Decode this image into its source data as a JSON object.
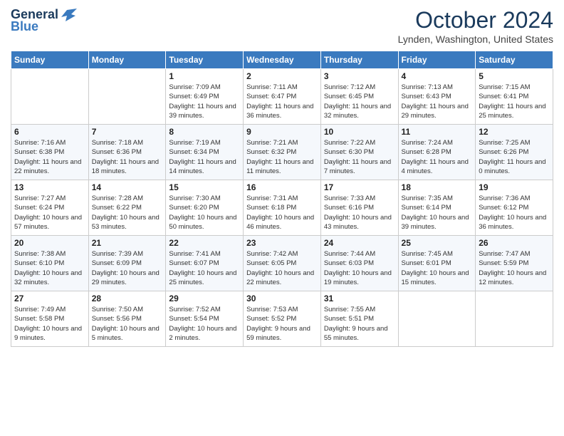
{
  "header": {
    "logo_general": "General",
    "logo_blue": "Blue",
    "month_title": "October 2024",
    "location": "Lynden, Washington, United States"
  },
  "weekdays": [
    "Sunday",
    "Monday",
    "Tuesday",
    "Wednesday",
    "Thursday",
    "Friday",
    "Saturday"
  ],
  "weeks": [
    [
      null,
      null,
      {
        "day": "1",
        "sunrise": "Sunrise: 7:09 AM",
        "sunset": "Sunset: 6:49 PM",
        "daylight": "Daylight: 11 hours and 39 minutes."
      },
      {
        "day": "2",
        "sunrise": "Sunrise: 7:11 AM",
        "sunset": "Sunset: 6:47 PM",
        "daylight": "Daylight: 11 hours and 36 minutes."
      },
      {
        "day": "3",
        "sunrise": "Sunrise: 7:12 AM",
        "sunset": "Sunset: 6:45 PM",
        "daylight": "Daylight: 11 hours and 32 minutes."
      },
      {
        "day": "4",
        "sunrise": "Sunrise: 7:13 AM",
        "sunset": "Sunset: 6:43 PM",
        "daylight": "Daylight: 11 hours and 29 minutes."
      },
      {
        "day": "5",
        "sunrise": "Sunrise: 7:15 AM",
        "sunset": "Sunset: 6:41 PM",
        "daylight": "Daylight: 11 hours and 25 minutes."
      }
    ],
    [
      {
        "day": "6",
        "sunrise": "Sunrise: 7:16 AM",
        "sunset": "Sunset: 6:38 PM",
        "daylight": "Daylight: 11 hours and 22 minutes."
      },
      {
        "day": "7",
        "sunrise": "Sunrise: 7:18 AM",
        "sunset": "Sunset: 6:36 PM",
        "daylight": "Daylight: 11 hours and 18 minutes."
      },
      {
        "day": "8",
        "sunrise": "Sunrise: 7:19 AM",
        "sunset": "Sunset: 6:34 PM",
        "daylight": "Daylight: 11 hours and 14 minutes."
      },
      {
        "day": "9",
        "sunrise": "Sunrise: 7:21 AM",
        "sunset": "Sunset: 6:32 PM",
        "daylight": "Daylight: 11 hours and 11 minutes."
      },
      {
        "day": "10",
        "sunrise": "Sunrise: 7:22 AM",
        "sunset": "Sunset: 6:30 PM",
        "daylight": "Daylight: 11 hours and 7 minutes."
      },
      {
        "day": "11",
        "sunrise": "Sunrise: 7:24 AM",
        "sunset": "Sunset: 6:28 PM",
        "daylight": "Daylight: 11 hours and 4 minutes."
      },
      {
        "day": "12",
        "sunrise": "Sunrise: 7:25 AM",
        "sunset": "Sunset: 6:26 PM",
        "daylight": "Daylight: 11 hours and 0 minutes."
      }
    ],
    [
      {
        "day": "13",
        "sunrise": "Sunrise: 7:27 AM",
        "sunset": "Sunset: 6:24 PM",
        "daylight": "Daylight: 10 hours and 57 minutes."
      },
      {
        "day": "14",
        "sunrise": "Sunrise: 7:28 AM",
        "sunset": "Sunset: 6:22 PM",
        "daylight": "Daylight: 10 hours and 53 minutes."
      },
      {
        "day": "15",
        "sunrise": "Sunrise: 7:30 AM",
        "sunset": "Sunset: 6:20 PM",
        "daylight": "Daylight: 10 hours and 50 minutes."
      },
      {
        "day": "16",
        "sunrise": "Sunrise: 7:31 AM",
        "sunset": "Sunset: 6:18 PM",
        "daylight": "Daylight: 10 hours and 46 minutes."
      },
      {
        "day": "17",
        "sunrise": "Sunrise: 7:33 AM",
        "sunset": "Sunset: 6:16 PM",
        "daylight": "Daylight: 10 hours and 43 minutes."
      },
      {
        "day": "18",
        "sunrise": "Sunrise: 7:35 AM",
        "sunset": "Sunset: 6:14 PM",
        "daylight": "Daylight: 10 hours and 39 minutes."
      },
      {
        "day": "19",
        "sunrise": "Sunrise: 7:36 AM",
        "sunset": "Sunset: 6:12 PM",
        "daylight": "Daylight: 10 hours and 36 minutes."
      }
    ],
    [
      {
        "day": "20",
        "sunrise": "Sunrise: 7:38 AM",
        "sunset": "Sunset: 6:10 PM",
        "daylight": "Daylight: 10 hours and 32 minutes."
      },
      {
        "day": "21",
        "sunrise": "Sunrise: 7:39 AM",
        "sunset": "Sunset: 6:09 PM",
        "daylight": "Daylight: 10 hours and 29 minutes."
      },
      {
        "day": "22",
        "sunrise": "Sunrise: 7:41 AM",
        "sunset": "Sunset: 6:07 PM",
        "daylight": "Daylight: 10 hours and 25 minutes."
      },
      {
        "day": "23",
        "sunrise": "Sunrise: 7:42 AM",
        "sunset": "Sunset: 6:05 PM",
        "daylight": "Daylight: 10 hours and 22 minutes."
      },
      {
        "day": "24",
        "sunrise": "Sunrise: 7:44 AM",
        "sunset": "Sunset: 6:03 PM",
        "daylight": "Daylight: 10 hours and 19 minutes."
      },
      {
        "day": "25",
        "sunrise": "Sunrise: 7:45 AM",
        "sunset": "Sunset: 6:01 PM",
        "daylight": "Daylight: 10 hours and 15 minutes."
      },
      {
        "day": "26",
        "sunrise": "Sunrise: 7:47 AM",
        "sunset": "Sunset: 5:59 PM",
        "daylight": "Daylight: 10 hours and 12 minutes."
      }
    ],
    [
      {
        "day": "27",
        "sunrise": "Sunrise: 7:49 AM",
        "sunset": "Sunset: 5:58 PM",
        "daylight": "Daylight: 10 hours and 9 minutes."
      },
      {
        "day": "28",
        "sunrise": "Sunrise: 7:50 AM",
        "sunset": "Sunset: 5:56 PM",
        "daylight": "Daylight: 10 hours and 5 minutes."
      },
      {
        "day": "29",
        "sunrise": "Sunrise: 7:52 AM",
        "sunset": "Sunset: 5:54 PM",
        "daylight": "Daylight: 10 hours and 2 minutes."
      },
      {
        "day": "30",
        "sunrise": "Sunrise: 7:53 AM",
        "sunset": "Sunset: 5:52 PM",
        "daylight": "Daylight: 9 hours and 59 minutes."
      },
      {
        "day": "31",
        "sunrise": "Sunrise: 7:55 AM",
        "sunset": "Sunset: 5:51 PM",
        "daylight": "Daylight: 9 hours and 55 minutes."
      },
      null,
      null
    ]
  ]
}
